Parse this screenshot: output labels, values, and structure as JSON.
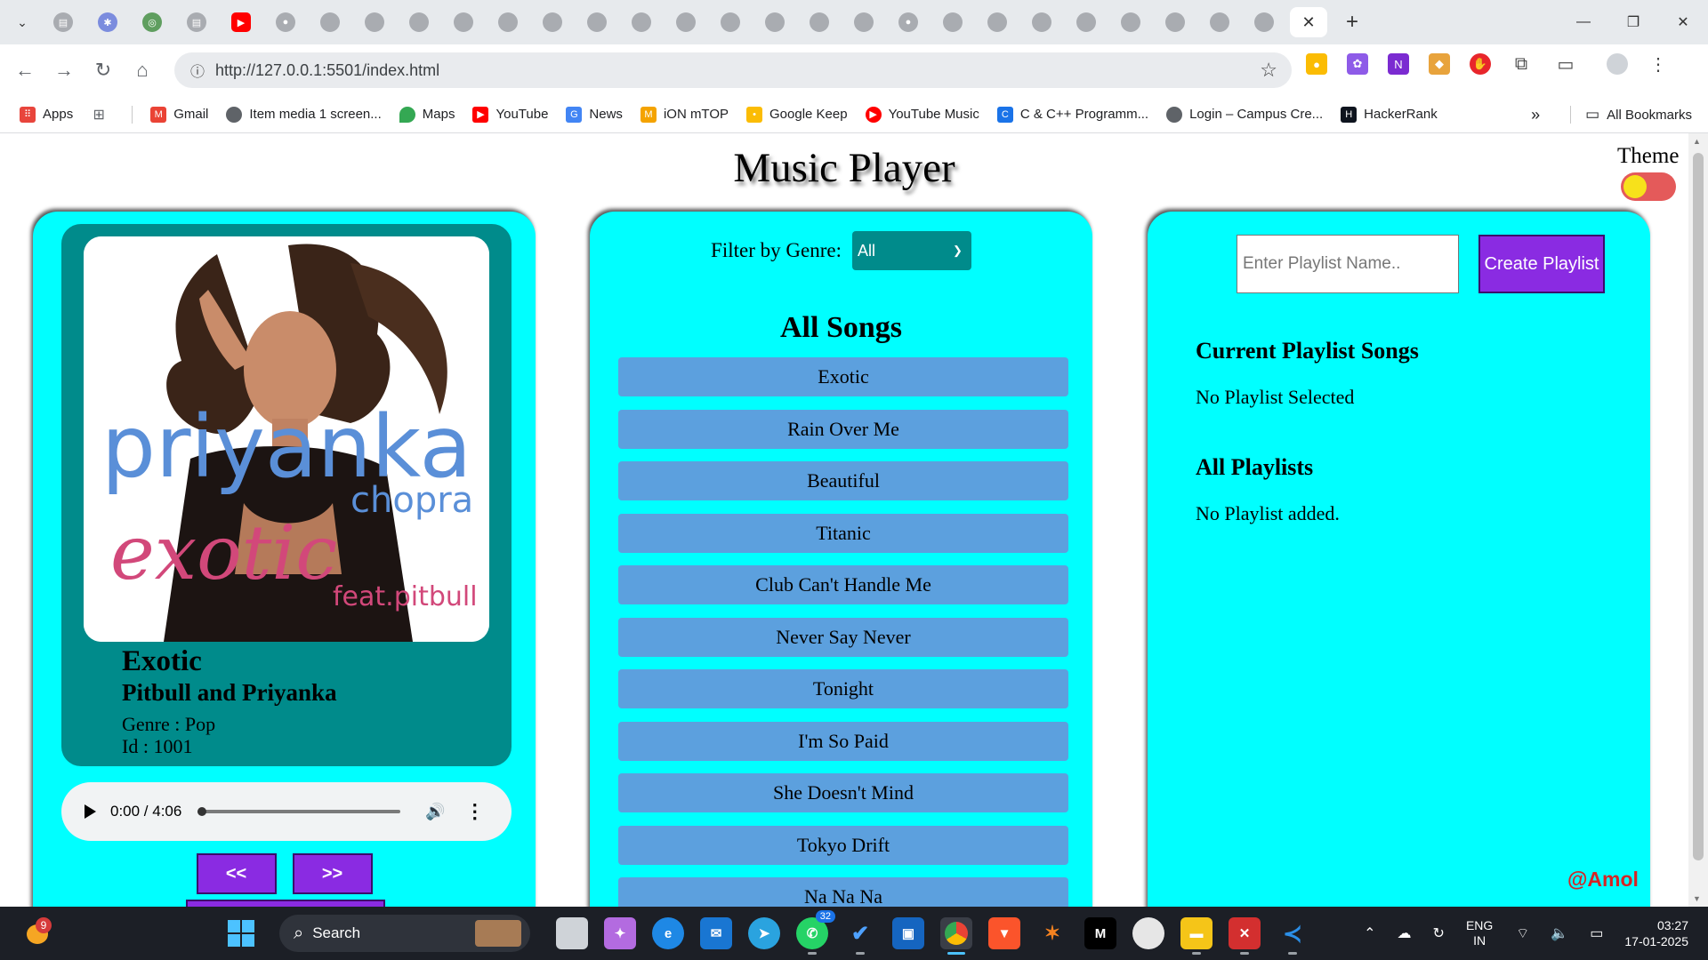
{
  "browser": {
    "url": "http://127.0.0.1:5501/index.html",
    "tabs": [
      {
        "icon": "doc-icon",
        "color": "#a9acb1"
      },
      {
        "icon": "bug-icon",
        "color": "#7b8cde"
      },
      {
        "icon": "chrome-icon",
        "color": "#5f9e5f"
      },
      {
        "icon": "doc-icon",
        "color": "#a9acb1"
      },
      {
        "icon": "youtube-icon",
        "color": "#ff0000"
      },
      {
        "icon": "github-icon",
        "color": "#a9acb1"
      }
    ],
    "bookmarks": [
      {
        "label": "Apps",
        "icon": "apps-icon",
        "color": "#e8453c"
      },
      {
        "label": "",
        "icon": "grid-icon",
        "color": "#5f6368"
      },
      {
        "label": "Gmail",
        "icon": "gmail-icon",
        "color": "#ea4335"
      },
      {
        "label": "Item media 1 screen...",
        "icon": "globe-icon",
        "color": "#5f6368"
      },
      {
        "label": "Maps",
        "icon": "maps-icon",
        "color": "#34a853"
      },
      {
        "label": "YouTube",
        "icon": "youtube-icon",
        "color": "#ff0000"
      },
      {
        "label": "News",
        "icon": "news-icon",
        "color": "#4285f4"
      },
      {
        "label": "iON mTOP",
        "icon": "ion-icon",
        "color": "#f4a300"
      },
      {
        "label": "Google Keep",
        "icon": "keep-icon",
        "color": "#fbbc04"
      },
      {
        "label": "YouTube Music",
        "icon": "youtube-music-icon",
        "color": "#ff0000"
      },
      {
        "label": "C & C++ Programm...",
        "icon": "cpp-icon",
        "color": "#1a73e8"
      },
      {
        "label": "Login – Campus Cre...",
        "icon": "globe-icon",
        "color": "#5f6368"
      },
      {
        "label": "HackerRank",
        "icon": "hackerrank-icon",
        "color": "#1ba94c"
      }
    ],
    "all_bookmarks": "All Bookmarks"
  },
  "page": {
    "title": "Music Player",
    "theme_label": "Theme",
    "player": {
      "song_title": "Exotic",
      "artist": "Pitbull and Priyanka",
      "genre": "Genre : Pop",
      "id": "Id : 1001",
      "cover_text_main": "priyanka",
      "cover_text_sub": "chopra",
      "cover_text_script": "exotic",
      "cover_text_feat": "feat.pitbull",
      "time": "0:00 / 4:06",
      "progress": 0,
      "prev_label": "<<",
      "next_label": ">>"
    },
    "songs": {
      "filter_label": "Filter by Genre:",
      "filter_value": "All",
      "heading": "All Songs",
      "items": [
        "Exotic",
        "Rain Over Me",
        "Beautiful",
        "Titanic",
        "Club Can't Handle Me",
        "Never Say Never",
        "Tonight",
        "I'm So Paid",
        "She Doesn't Mind",
        "Tokyo Drift",
        "Na Na Na"
      ]
    },
    "playlist": {
      "input_placeholder": "Enter Playlist Name..",
      "create_label": "Create Playlist",
      "current_heading": "Current Playlist Songs",
      "current_text": "No Playlist Selected",
      "all_heading": "All Playlists",
      "all_text": "No Playlist added."
    },
    "credit": "@Amol"
  },
  "taskbar": {
    "weather_badge": "9",
    "search_label": "Search",
    "whatsapp_count": "32",
    "lang": "ENG",
    "region": "IN",
    "time": "03:27",
    "date": "17-01-2025"
  },
  "colors": {
    "panel": "#00ffff",
    "card": "#008b8b",
    "song_item": "#5ca0de",
    "button": "#8a2be2",
    "credit": "#d62424"
  }
}
